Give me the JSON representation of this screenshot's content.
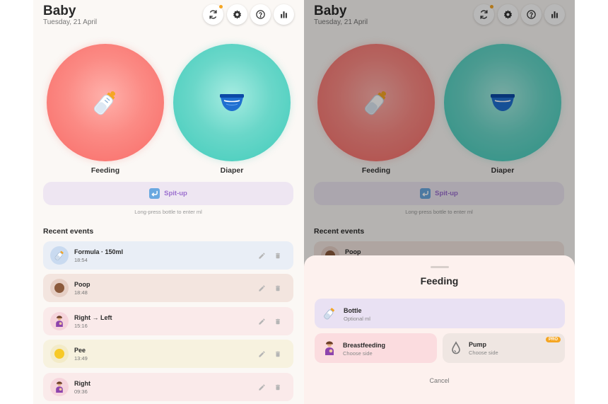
{
  "home": {
    "title": "Baby",
    "date": "Tuesday, 21 April",
    "feeding_label": "Feeding",
    "diaper_label": "Diaper",
    "spitup_label": "Spit-up",
    "hint": "Long-press bottle to enter ml",
    "recent_title": "Recent events",
    "events": [
      {
        "name": "Formula · 150ml",
        "time": "18:54",
        "icon": "baby-bottle-icon"
      },
      {
        "name": "Poop",
        "time": "18:48",
        "icon": "brown-circle-icon"
      },
      {
        "name": "Right → Left",
        "time": "15:16",
        "icon": "breastfeeding-icon"
      },
      {
        "name": "Pee",
        "time": "13:49",
        "icon": "yellow-circle-icon"
      },
      {
        "name": "Right",
        "time": "09:36",
        "icon": "breastfeeding-icon"
      }
    ]
  },
  "sheet": {
    "title": "Feeding",
    "bottle_title": "Bottle",
    "bottle_sub": "Optional ml",
    "breast_title": "Breastfeeding",
    "breast_sub": "Choose side",
    "pump_title": "Pump",
    "pump_sub": "Choose side",
    "pump_badge": "PRO",
    "cancel": "Cancel"
  },
  "colors": {
    "feeding": "#f96a66",
    "diaper": "#3ecbba",
    "accent_purple": "#9b6fcf",
    "pro_badge": "#f5a623"
  }
}
